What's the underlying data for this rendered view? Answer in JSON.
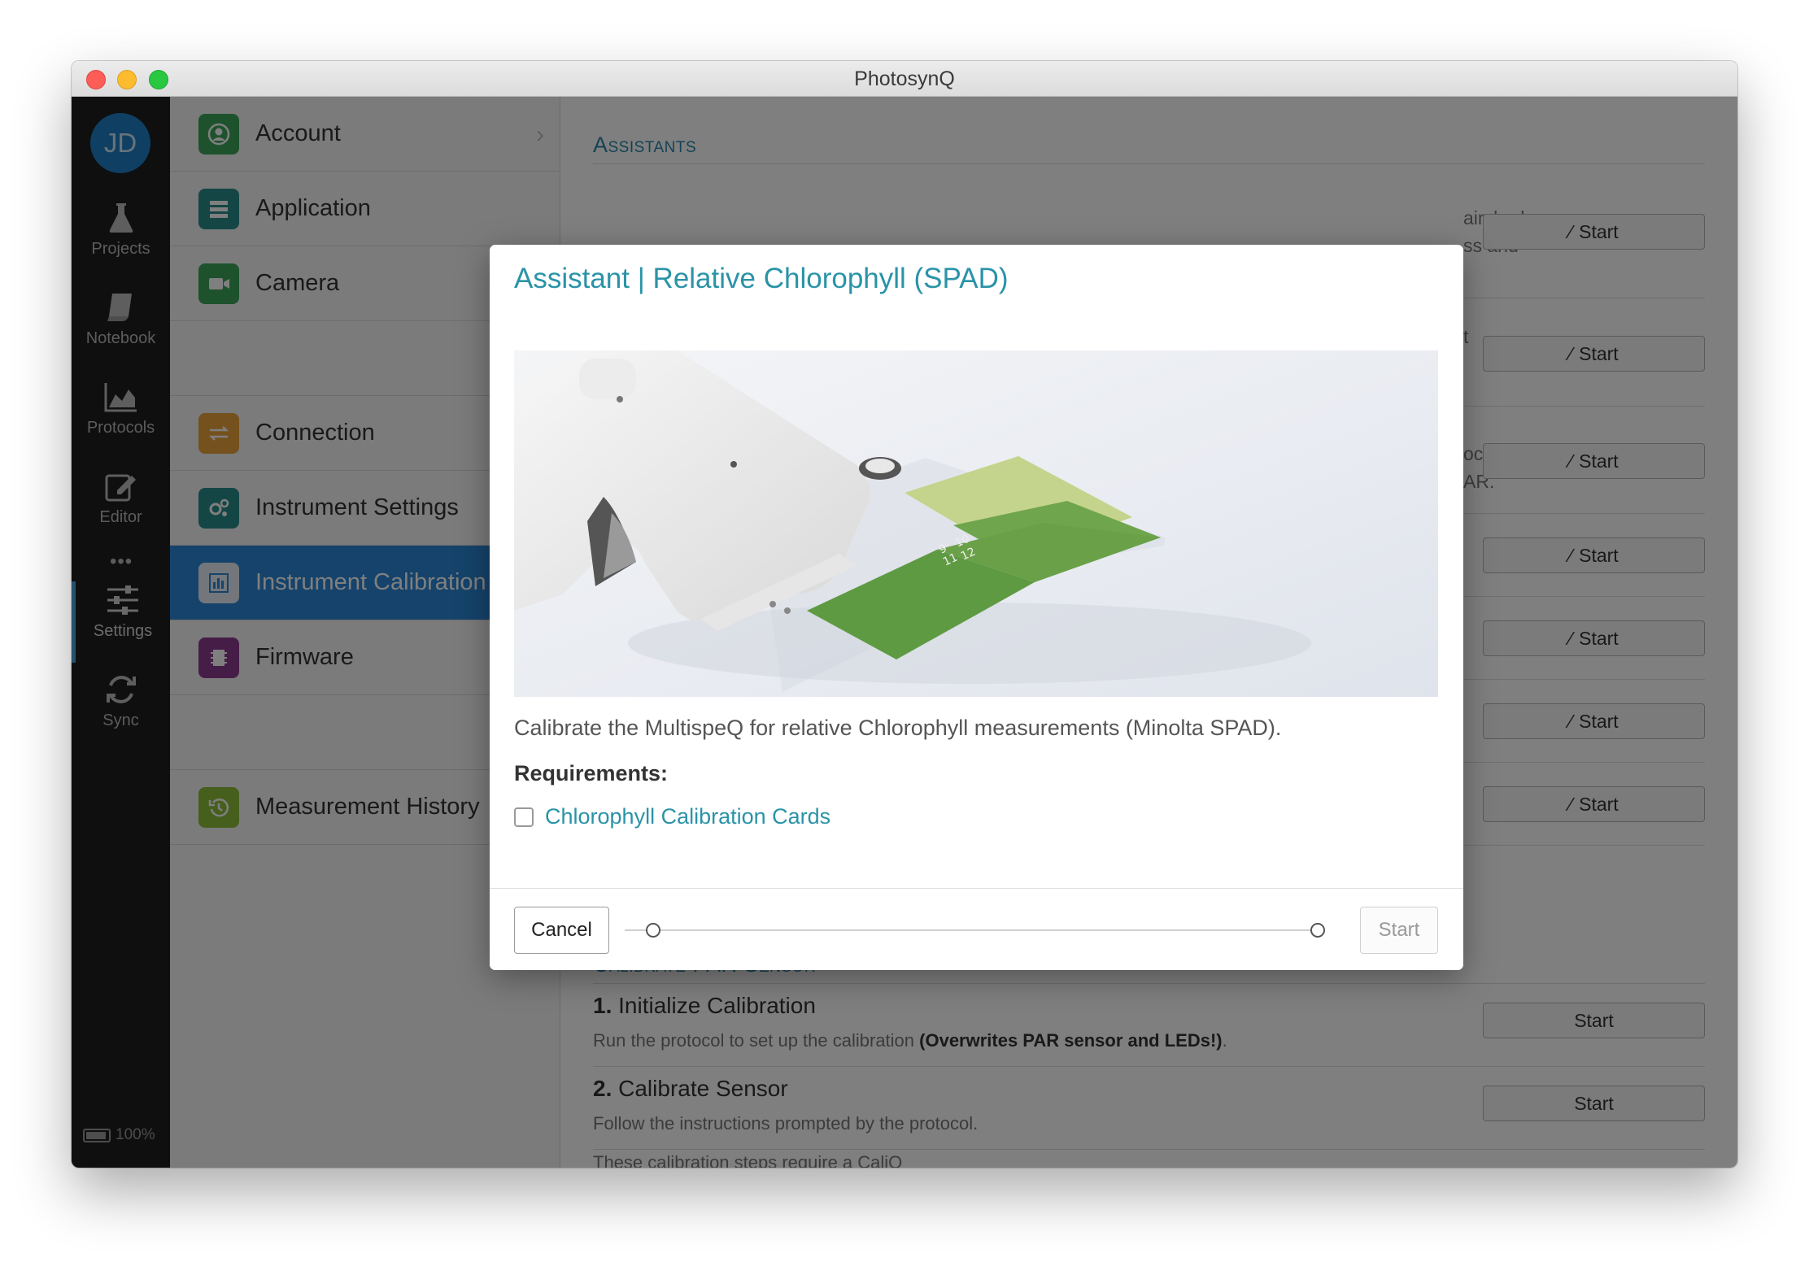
{
  "window": {
    "title": "PhotosynQ"
  },
  "rail": {
    "avatar_initials": "JD",
    "items": [
      {
        "label": "Projects",
        "icon": "flask-icon"
      },
      {
        "label": "Notebook",
        "icon": "notebook-icon"
      },
      {
        "label": "Protocols",
        "icon": "chart-area-icon"
      },
      {
        "label": "Editor",
        "icon": "edit-icon"
      },
      {
        "label": "Settings",
        "icon": "sliders-icon"
      },
      {
        "label": "Sync",
        "icon": "sync-icon"
      }
    ],
    "more_dots": "•••",
    "battery": "100%"
  },
  "menu": {
    "items": [
      {
        "label": "Account",
        "icon": "account-icon",
        "color": "#3aa55a"
      },
      {
        "label": "Application",
        "icon": "application-icon",
        "color": "#2a8c8c"
      },
      {
        "label": "Camera",
        "icon": "camera-icon",
        "color": "#3aa55a"
      },
      {
        "label": "Connection",
        "icon": "connection-icon",
        "color": "#e8a23a"
      },
      {
        "label": "Instrument Settings",
        "icon": "instrument-settings-icon",
        "color": "#2a8c8c"
      },
      {
        "label": "Instrument Calibration",
        "icon": "calibration-icon",
        "color": "#2a86d6"
      },
      {
        "label": "Firmware",
        "icon": "firmware-icon",
        "color": "#8c3a8c"
      },
      {
        "label": "Measurement History",
        "icon": "history-icon",
        "color": "#8cbf3a"
      }
    ]
  },
  "main": {
    "assistants_title": "Assistants",
    "fragments": {
      "row1_line1": "ain body",
      "row1_line2": "ss and",
      "row2": "t",
      "row3_line1": "ocols.",
      "row3_line2": "AR."
    },
    "start_label": "Start",
    "par": {
      "title": "Calibrate PAR Sensor",
      "step1_num": "1.",
      "step1_title": "Initialize Calibration",
      "step1_desc": "Run the protocol to set up the calibration ",
      "step1_bold": "(Overwrites PAR sensor and LEDs!)",
      "step1_end": ".",
      "step2_num": "2.",
      "step2_title": "Calibrate Sensor",
      "step2_desc": "Follow the instructions prompted by the protocol.",
      "cutoff_text": "These calibration steps require a CaliQ"
    }
  },
  "modal": {
    "title": "Assistant | Relative Chlorophyll (SPAD)",
    "description": "Calibrate the MultispeQ for relative Chlorophyll measurements (Minolta SPAD).",
    "requirements_title": "Requirements:",
    "requirement_item": "Chlorophyll Calibration Cards",
    "requirement_checked": false,
    "cancel_label": "Cancel",
    "start_label": "Start",
    "image_card_labels": [
      "9",
      "10",
      "11",
      "12"
    ]
  },
  "colors": {
    "accent": "#2a93a8",
    "active_menu": "#2a86d6",
    "rail_bg": "#1e1e1e"
  }
}
